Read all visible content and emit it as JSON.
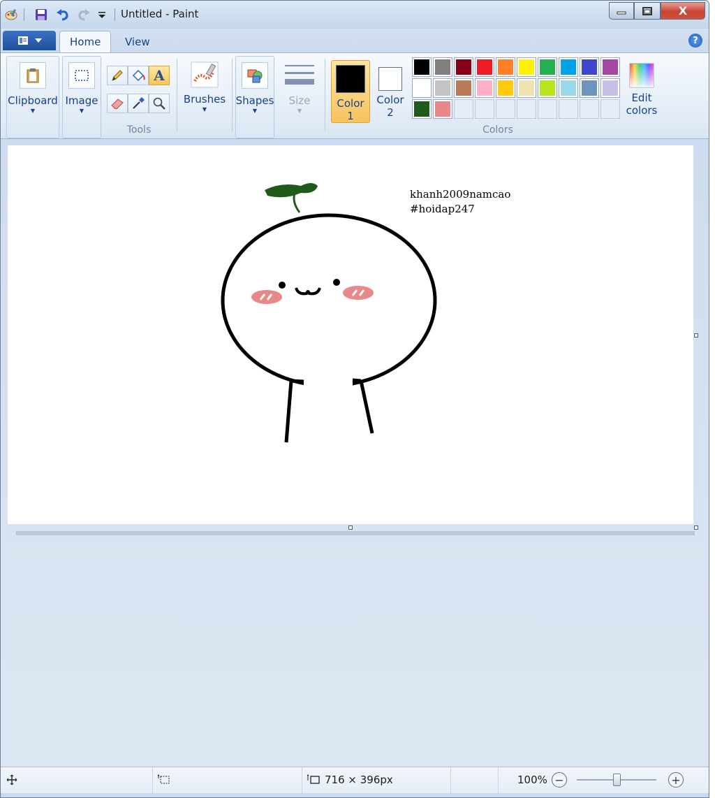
{
  "window": {
    "title": "Untitled - Paint"
  },
  "title_controls": {
    "minimize": "minimize",
    "maximize": "maximize",
    "close": "X"
  },
  "tabs": [
    {
      "label": "Home",
      "active": true
    },
    {
      "label": "View",
      "active": false
    }
  ],
  "help": "?",
  "ribbon": {
    "clipboard": {
      "label": "Clipboard"
    },
    "image": {
      "label": "Image"
    },
    "tools": {
      "label": "Tools"
    },
    "brushes": {
      "label": "Brushes"
    },
    "shapes": {
      "label": "Shapes"
    },
    "size": {
      "label": "Size"
    },
    "colors": {
      "label": "Colors",
      "color1": {
        "label_line1": "Color",
        "label_line2": "1",
        "value": "#000000"
      },
      "color2": {
        "label_line1": "Color",
        "label_line2": "2",
        "value": "#ffffff"
      },
      "edit_line1": "Edit",
      "edit_line2": "colors",
      "palette": [
        "#000000",
        "#7f7f7f",
        "#880015",
        "#ed1c24",
        "#ff7f27",
        "#fff200",
        "#22b14c",
        "#00a2e8",
        "#3f48cc",
        "#a349a4",
        "#ffffff",
        "#c3c3c3",
        "#b97a57",
        "#ffaec9",
        "#ffc90e",
        "#efe4b0",
        "#b5e61d",
        "#99d9ea",
        "#7092be",
        "#c8bfe7",
        "#1f5a1a",
        "#e88888",
        "",
        "",
        "",
        "",
        "",
        "",
        "",
        ""
      ]
    }
  },
  "canvas": {
    "text_line1": "khanh2009namcao",
    "text_line2": "#hoidap247"
  },
  "statusbar": {
    "image_size": "716 × 396px",
    "zoom": "100%",
    "zoom_level_percent": 100
  }
}
